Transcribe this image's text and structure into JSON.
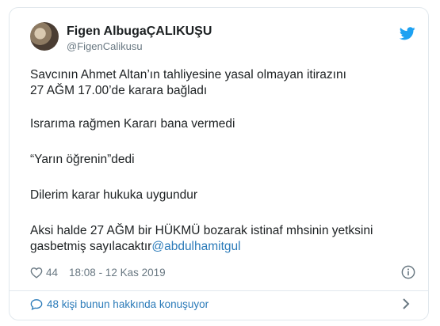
{
  "author": {
    "name": "Figen AlbugaÇALIKUŞU",
    "handle": "@FigenCalikusu"
  },
  "tweet": {
    "line1a": "Savcının Ahmet Altan’ın tahliyesine yasal olmayan itirazını",
    "line1b": "27 AĞM 17.00’de karara bağladı",
    "line2": "Israrıma rağmen Kararı bana vermedi",
    "line3": "“Yarın öğrenin”dedi",
    "line4": "Dilerim karar hukuka uygundur",
    "line5a": "Aksi halde 27 AĞM bir HÜKMÜ bozarak istinaf mhsinin yetksini",
    "line5b": "gasbetmiş sayılacaktır",
    "mention": "@abdulhamitgul"
  },
  "meta": {
    "likes": "44",
    "timestamp": "18:08 - 12 Kas 2019"
  },
  "conversation": {
    "label": "48 kişi bunun hakkında konuşuyor"
  },
  "colors": {
    "accent": "#1da1f2",
    "link": "#2b7bb9",
    "muted": "#697882",
    "border": "#e1e8ed"
  },
  "icons": [
    "twitter-bird-icon",
    "heart-icon",
    "info-icon",
    "speech-bubble-icon",
    "chevron-right-icon"
  ]
}
